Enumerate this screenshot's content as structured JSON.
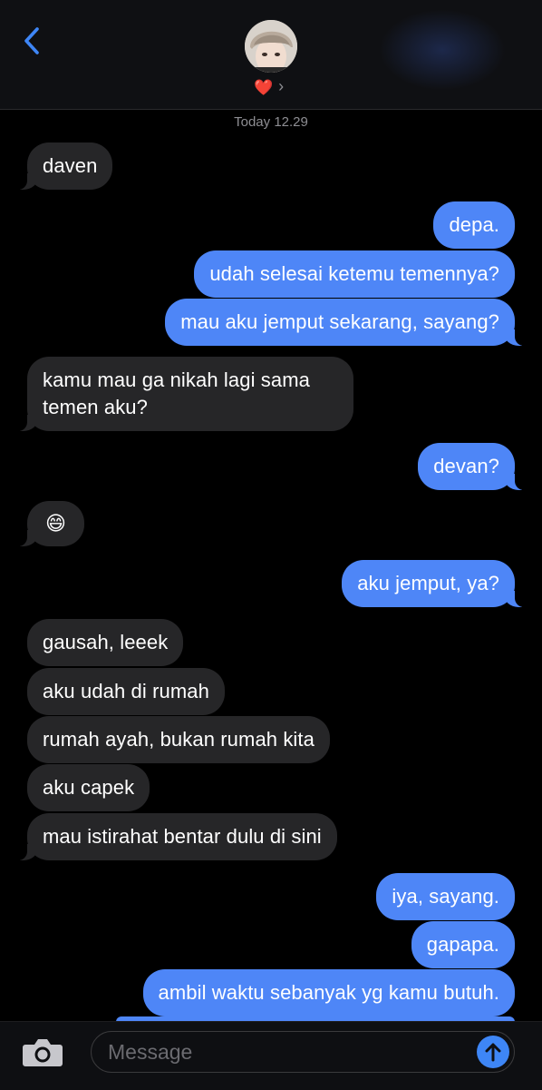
{
  "header": {
    "back_icon": "chevron-left-icon",
    "contact_emoji": "❤️",
    "chevron": "›"
  },
  "timestamp": "Today 12.29",
  "messages": [
    {
      "dir": "in",
      "text": "daven"
    },
    {
      "dir": "out",
      "text": "depa."
    },
    {
      "dir": "out",
      "text": "udah selesai ketemu temennya?"
    },
    {
      "dir": "out",
      "text": "mau aku jemput sekarang, sayang?"
    },
    {
      "dir": "in",
      "text": "kamu mau ga nikah lagi sama temen aku?"
    },
    {
      "dir": "out",
      "text": "devan?"
    },
    {
      "dir": "in",
      "text": "😄"
    },
    {
      "dir": "out",
      "text": "aku jemput, ya?"
    },
    {
      "dir": "in",
      "text": "gausah, leeek"
    },
    {
      "dir": "in",
      "text": "aku udah di rumah"
    },
    {
      "dir": "in",
      "text": "rumah ayah, bukan rumah kita"
    },
    {
      "dir": "in",
      "text": "aku capek"
    },
    {
      "dir": "in",
      "text": "mau istirahat bentar dulu di sini"
    },
    {
      "dir": "out",
      "text": "iya, sayang."
    },
    {
      "dir": "out",
      "text": "gapapa."
    },
    {
      "dir": "out",
      "text": "ambil waktu sebanyak yg kamu butuh."
    }
  ],
  "composer": {
    "placeholder": "Message",
    "camera_icon": "camera-icon",
    "send_icon": "arrow-up-icon"
  },
  "colors": {
    "incoming_bubble": "#262628",
    "outgoing_bubble": "#4e86f7",
    "accent": "#3e86f6"
  }
}
